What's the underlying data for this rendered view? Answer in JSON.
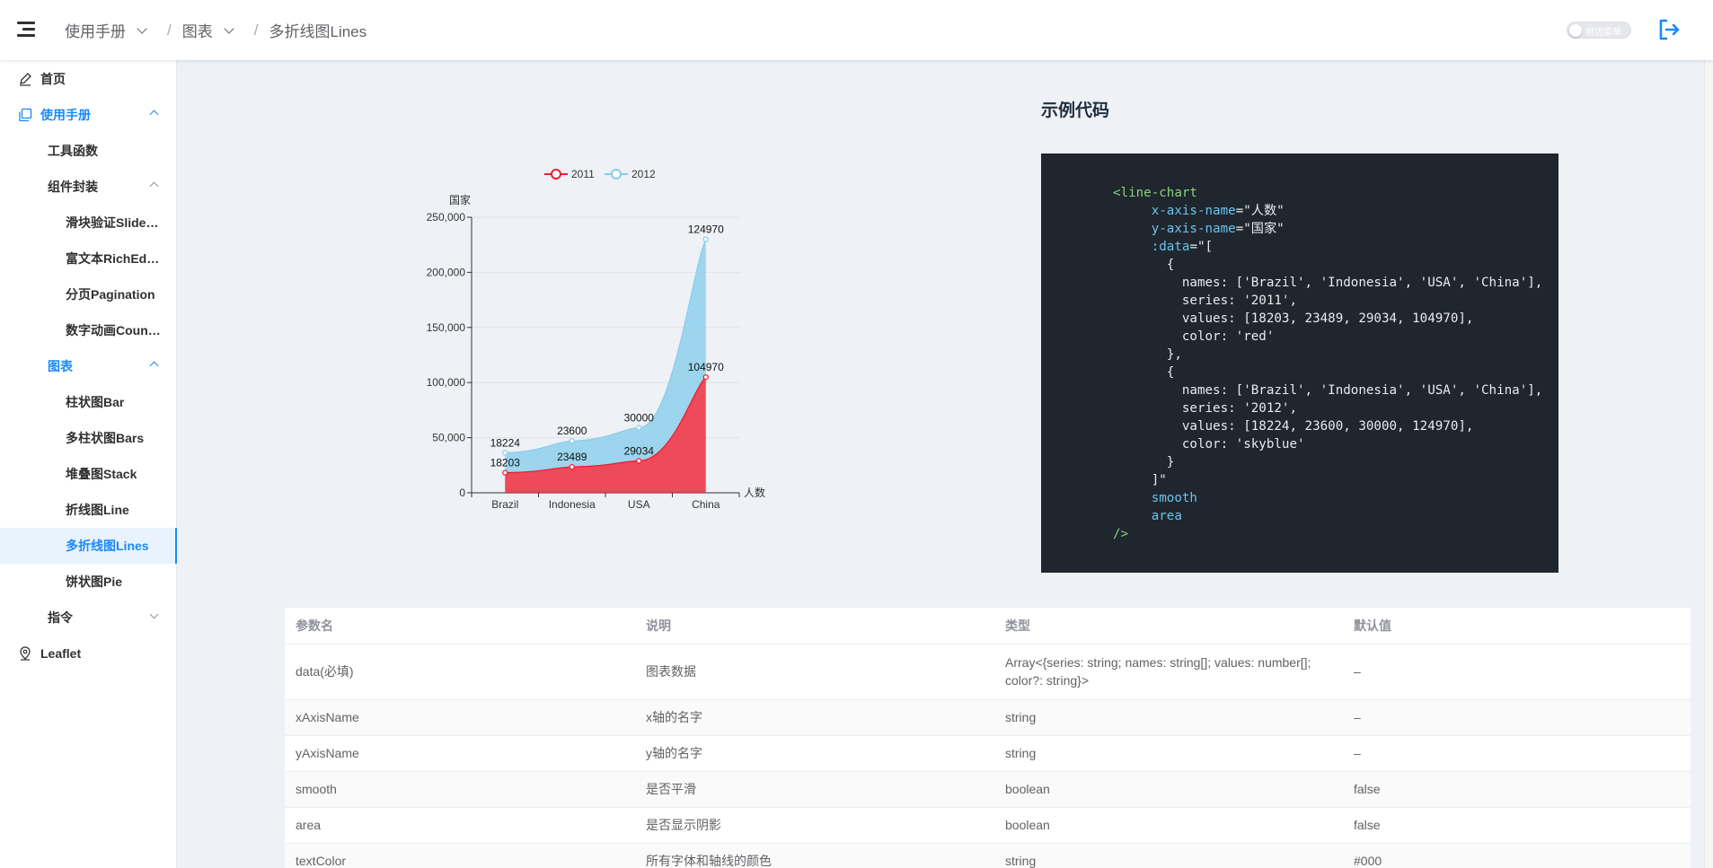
{
  "header": {
    "breadcrumb": [
      "使用手册",
      "图表",
      "多折线图Lines"
    ],
    "side_toggle_label": "侧边菜单"
  },
  "sidebar": {
    "items": [
      {
        "label": "首页",
        "icon": "edit-icon"
      },
      {
        "label": "使用手册",
        "icon": "copy-icon"
      },
      {
        "label": "工具函数"
      },
      {
        "label": "组件封装"
      },
      {
        "label": "滑块验证SliderVerify"
      },
      {
        "label": "富文本RichEditor"
      },
      {
        "label": "分页Pagination"
      },
      {
        "label": "数字动画CountTo"
      },
      {
        "label": "图表"
      },
      {
        "label": "柱状图Bar"
      },
      {
        "label": "多柱状图Bars"
      },
      {
        "label": "堆叠图Stack"
      },
      {
        "label": "折线图Line"
      },
      {
        "label": "多折线图Lines"
      },
      {
        "label": "饼状图Pie"
      },
      {
        "label": "指令"
      },
      {
        "label": "Leaflet",
        "icon": "location-icon"
      }
    ]
  },
  "chart_data": {
    "type": "area",
    "categories": [
      "Brazil",
      "Indonesia",
      "USA",
      "China"
    ],
    "series": [
      {
        "name": "2011",
        "values": [
          18203,
          23489,
          29034,
          104970
        ],
        "color": "#ee1b2e"
      },
      {
        "name": "2012",
        "values": [
          18224,
          23600,
          30000,
          124970
        ],
        "color": "#87ceeb"
      }
    ],
    "stacked": true,
    "smooth": true,
    "xlabel": "人数",
    "ylabel": "国家",
    "ylim": [
      0,
      250000
    ],
    "yticks": [
      "0",
      "50,000",
      "100,000",
      "150,000",
      "200,000",
      "250,000"
    ],
    "legend": "top-center",
    "grid": true
  },
  "code": {
    "title": "示例代码"
  },
  "table": {
    "headers": [
      "参数名",
      "说明",
      "类型",
      "默认值"
    ],
    "rows": [
      [
        "data(必填)",
        "图表数据",
        "Array<{series: string; names: string[]; values: number[]; color?: string}>",
        "–"
      ],
      [
        "xAxisName",
        "x轴的名字",
        "string",
        "–"
      ],
      [
        "yAxisName",
        "y轴的名字",
        "string",
        "–"
      ],
      [
        "smooth",
        "是否平滑",
        "boolean",
        "false"
      ],
      [
        "area",
        "是否显示阴影",
        "boolean",
        "false"
      ],
      [
        "textColor",
        "所有字体和轴线的颜色",
        "string",
        "#000"
      ]
    ]
  },
  "colors": {
    "accent": "#1989fa",
    "code_bg": "#1f262e"
  }
}
